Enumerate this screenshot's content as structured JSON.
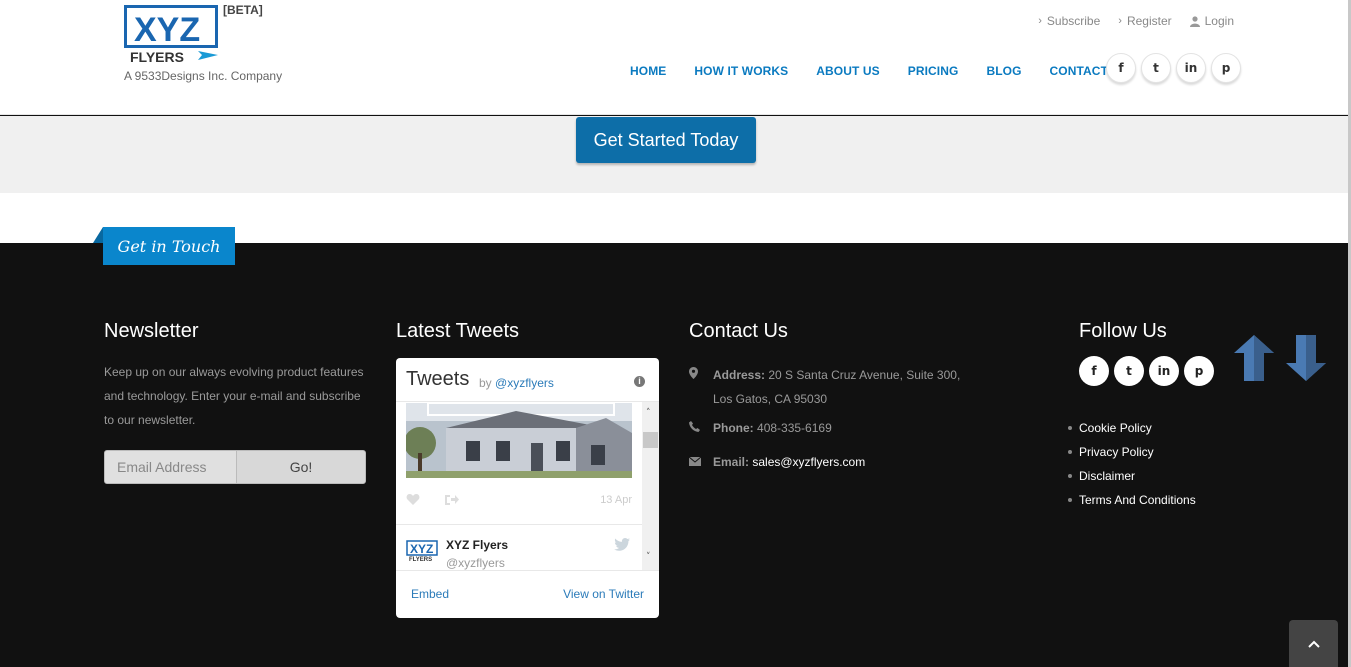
{
  "header": {
    "logo_text": "XYZ FLYERS",
    "beta": "[BETA]",
    "tagline": "A 9533Designs Inc. Company",
    "top_links": [
      {
        "label": "Subscribe",
        "icon": "chevron-right-icon"
      },
      {
        "label": "Register",
        "icon": "chevron-right-icon"
      },
      {
        "label": "Login",
        "icon": "user-icon"
      }
    ],
    "nav": [
      "HOME",
      "HOW IT WORKS",
      "ABOUT US",
      "PRICING",
      "BLOG",
      "CONTACT"
    ],
    "social": [
      {
        "icon": "facebook-icon",
        "glyph": "f"
      },
      {
        "icon": "twitter-icon",
        "glyph": "t"
      },
      {
        "icon": "linkedin-icon",
        "glyph": "in"
      },
      {
        "icon": "pinterest-icon",
        "glyph": "p"
      }
    ]
  },
  "cta": {
    "label": "Get Started Today"
  },
  "footer": {
    "get_in_touch": "Get in Touch",
    "newsletter": {
      "title": "Newsletter",
      "text": "Keep up on our always evolving product features and technology. Enter your e-mail and subscribe to our newsletter.",
      "placeholder": "Email Address",
      "button": "Go!"
    },
    "tweets": {
      "title": "Latest Tweets",
      "widget_title": "Tweets",
      "by": "by",
      "handle": "@xyzflyers",
      "date": "13 Apr",
      "author_name": "XYZ Flyers",
      "author_handle": "@xyzflyers",
      "embed": "Embed",
      "view": "View on Twitter"
    },
    "contact": {
      "title": "Contact Us",
      "address_label": "Address:",
      "address_line1": "20 S Santa Cruz Avenue, Suite 300,",
      "address_line2": "Los Gatos, CA 95030",
      "phone_label": "Phone:",
      "phone": "408-335-6169",
      "email_label": "Email:",
      "email": "sales@xyzflyers.com"
    },
    "follow": {
      "title": "Follow Us",
      "links": [
        "Cookie Policy",
        "Privacy Policy",
        "Disclaimer",
        "Terms And Conditions"
      ]
    }
  },
  "colors": {
    "accent": "#0a7ac0",
    "cta": "#0d6ea8",
    "badge": "#0a86cc",
    "footer_bg": "#111111"
  }
}
